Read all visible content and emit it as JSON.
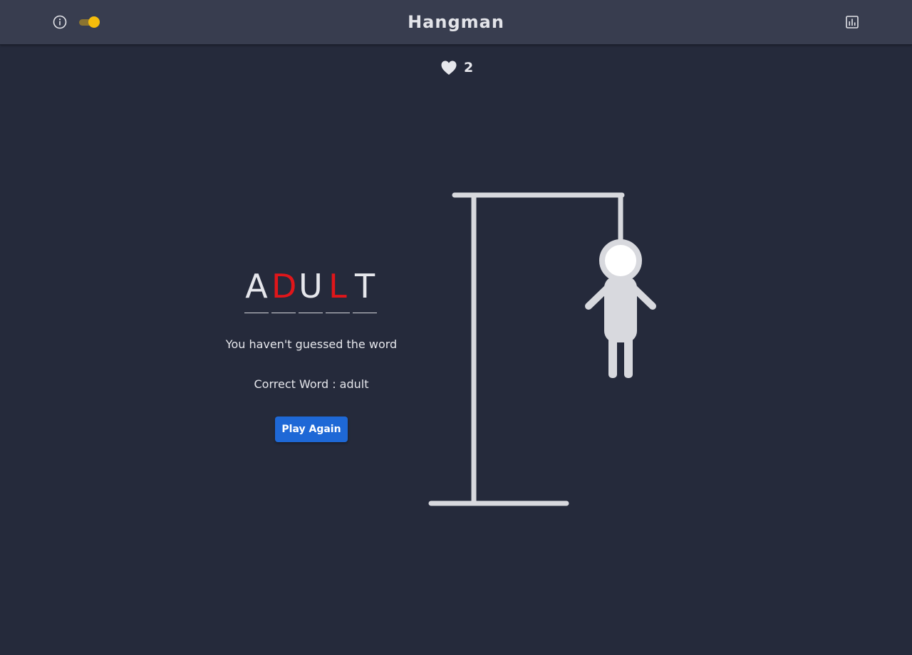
{
  "header": {
    "title": "Hangman",
    "info_icon": "info-icon",
    "theme_toggle": {
      "state": "on",
      "track_color": "#8b7430",
      "knob_color": "#f5bd0c"
    },
    "stats_icon": "bar-chart-icon"
  },
  "lives": {
    "icon": "heart-icon",
    "count": "2"
  },
  "word": {
    "letters": [
      {
        "char": "A",
        "color": "#e6e7ec"
      },
      {
        "char": "D",
        "color": "#e0161a"
      },
      {
        "char": "U",
        "color": "#e6e7ec"
      },
      {
        "char": "L",
        "color": "#e0161a"
      },
      {
        "char": "T",
        "color": "#e6e7ec"
      }
    ]
  },
  "result": {
    "message": "You haven't guessed the word",
    "correct_word_line": "Correct Word : adult",
    "play_again_label": "Play Again"
  },
  "colors": {
    "background": "#252a3b",
    "header": "#383d4f",
    "accent_button": "#1e68d6",
    "missed_letter": "#e0161a",
    "drawing": "#d8d9de"
  }
}
